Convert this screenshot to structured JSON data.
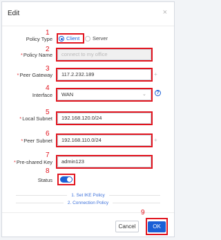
{
  "dialog": {
    "title": "Edit",
    "close_glyph": "×"
  },
  "annotations": [
    "1",
    "2",
    "3",
    "4",
    "5",
    "6",
    "7",
    "8",
    "9"
  ],
  "form": {
    "policy_type": {
      "label": "Policy Type",
      "options": [
        "Client",
        "Server"
      ],
      "selected": "Client"
    },
    "policy_name": {
      "label": "Policy Name",
      "required": true,
      "placeholder": "connect to my office",
      "disabled": true
    },
    "peer_gateway": {
      "label": "Peer Gateway",
      "required": true,
      "value": "117.2.232.189"
    },
    "interface": {
      "label": "Interface",
      "value": "WAN",
      "help_icon": "?"
    },
    "local_subnet": {
      "label": "Local Subnet",
      "required": true,
      "value": "192.168.120.0/24"
    },
    "peer_subnet": {
      "label": "Peer Subnet",
      "required": true,
      "value": "192.168.110.0/24"
    },
    "pre_shared_key": {
      "label": "Pre-shared Key",
      "required": true,
      "value": "admin123"
    },
    "status": {
      "label": "Status",
      "enabled": true
    }
  },
  "sections": [
    "1. Set IKE Policy",
    "2. Connection Policy"
  ],
  "buttons": {
    "cancel": "Cancel",
    "ok": "OK"
  },
  "plus_glyph": "+",
  "required_mark": "*",
  "icons": {
    "close": "close-icon",
    "dropdown": "chevron-down-icon",
    "help": "help-icon",
    "add": "plus-icon"
  },
  "colors": {
    "accent": "#1a5fd6",
    "annotation": "#e1141e",
    "required": "#e5353a"
  }
}
